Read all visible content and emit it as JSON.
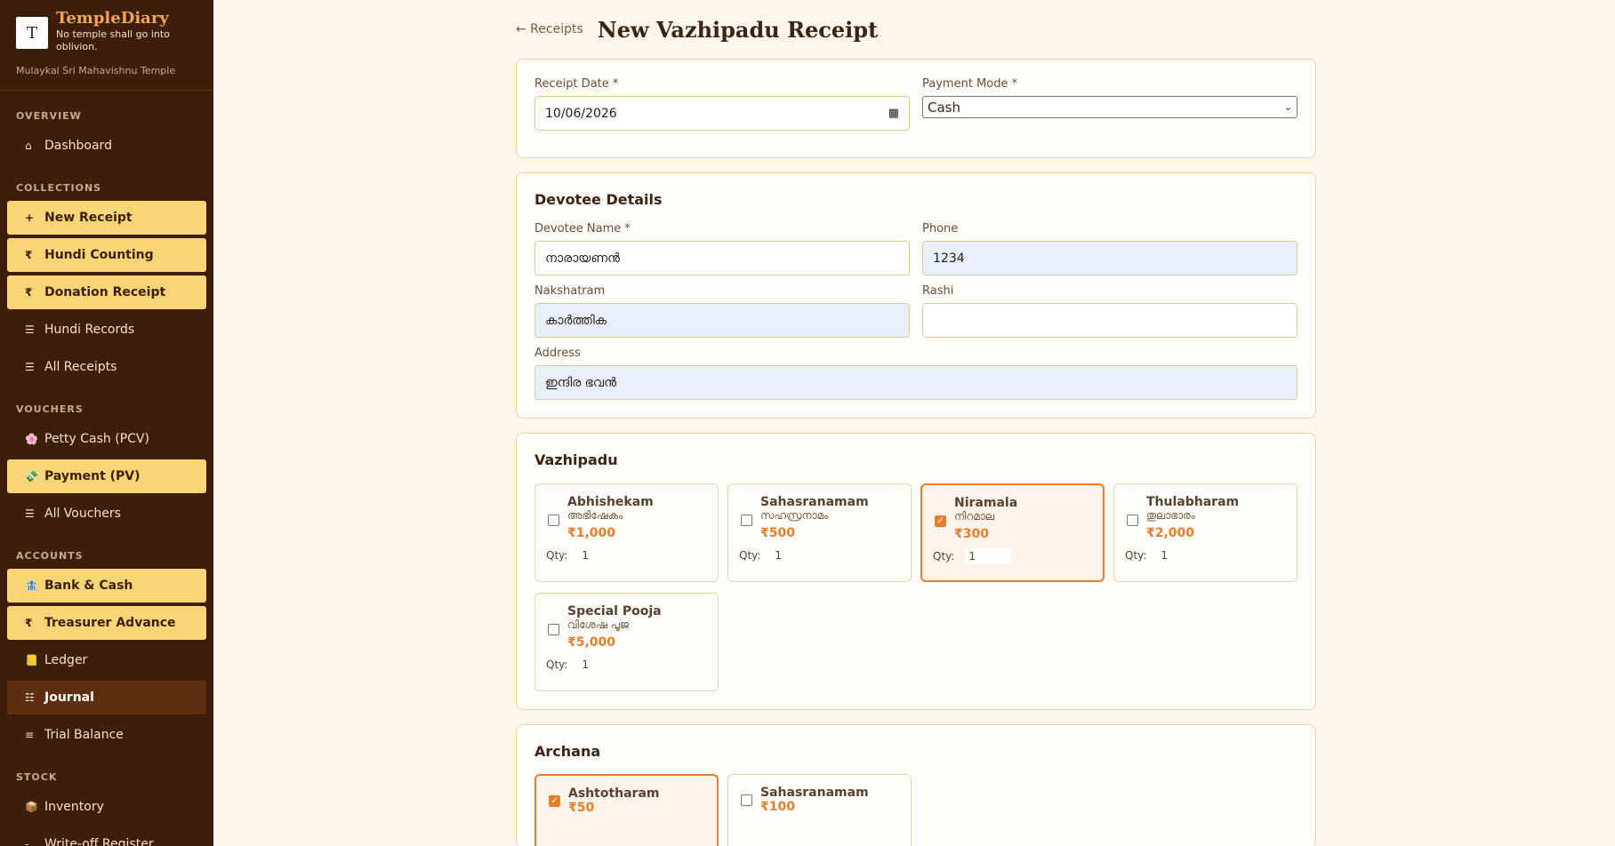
{
  "brand": {
    "logo_glyph": "T",
    "name": "TempleDiary",
    "tagline": "No temple shall go into oblivion.",
    "temple": "Mulaykal Sri Mahavishnu Temple"
  },
  "nav": {
    "overview_label": "OVERVIEW",
    "dashboard": {
      "icon": "⌂",
      "label": "Dashboard"
    },
    "collections_label": "COLLECTIONS",
    "new_receipt": {
      "icon": "+",
      "label": "New Receipt"
    },
    "hundi_counting": {
      "icon": "₹",
      "label": "Hundi Counting"
    },
    "donation_receipt": {
      "icon": "₹",
      "label": "Donation Receipt"
    },
    "hundi_records": {
      "icon": "☰",
      "label": "Hundi Records"
    },
    "all_receipts": {
      "icon": "☰",
      "label": "All Receipts"
    },
    "vouchers_label": "VOUCHERS",
    "petty_cash": {
      "icon": "🌸",
      "label": "Petty Cash (PCV)"
    },
    "payment": {
      "icon": "💸",
      "label": "Payment (PV)"
    },
    "all_vouchers": {
      "icon": "☰",
      "label": "All Vouchers"
    },
    "accounts_label": "ACCOUNTS",
    "bank_cash": {
      "icon": "🏦",
      "label": "Bank & Cash"
    },
    "treasurer_advance": {
      "icon": "₹",
      "label": "Treasurer Advance"
    },
    "ledger": {
      "icon": "📒",
      "label": "Ledger"
    },
    "journal": {
      "icon": "☷",
      "label": "Journal"
    },
    "trial_balance": {
      "icon": "≡",
      "label": "Trial Balance"
    },
    "stock_label": "STOCK",
    "inventory": {
      "icon": "📦",
      "label": "Inventory"
    },
    "writeoff": {
      "icon": "-",
      "label": "Write-off Register"
    }
  },
  "header": {
    "back_label": "← Receipts",
    "title": "New Vazhipadu Receipt"
  },
  "receipt": {
    "date_label": "Receipt Date *",
    "date_value": "10/06/2026",
    "mode_label": "Payment Mode *",
    "mode_value": "Cash"
  },
  "devotee": {
    "title": "Devotee Details",
    "name_label": "Devotee Name *",
    "name_value": "നാരായണൻ",
    "phone_label": "Phone",
    "phone_value": "1234",
    "nakshatram_label": "Nakshatram",
    "nakshatram_value": "കാർത്തിക",
    "rashi_label": "Rashi",
    "rashi_value": "",
    "address_label": "Address",
    "address_value": "ഇന്ദിര ഭവൻ"
  },
  "vazhipadu": {
    "title": "Vazhipadu",
    "qty_label": "Qty:",
    "items": [
      {
        "name": "Abhishekam",
        "ml": "അഭിഷേകം",
        "price": "₹1,000",
        "qty": "1",
        "checked": false
      },
      {
        "name": "Sahasranamam",
        "ml": "സഹസ്രനാമം",
        "price": "₹500",
        "qty": "1",
        "checked": false
      },
      {
        "name": "Niramala",
        "ml": "നിറമാല",
        "price": "₹300",
        "qty": "1",
        "checked": true
      },
      {
        "name": "Thulabharam",
        "ml": "തുലാഭാരം",
        "price": "₹2,000",
        "qty": "1",
        "checked": false
      },
      {
        "name": "Special Pooja",
        "ml": "വിശേഷ പൂജ",
        "price": "₹5,000",
        "qty": "1",
        "checked": false
      }
    ]
  },
  "archana": {
    "title": "Archana",
    "items": [
      {
        "name": "Ashtotharam",
        "price": "₹50",
        "checked": true
      },
      {
        "name": "Sahasranamam",
        "price": "₹100",
        "checked": false
      }
    ]
  }
}
